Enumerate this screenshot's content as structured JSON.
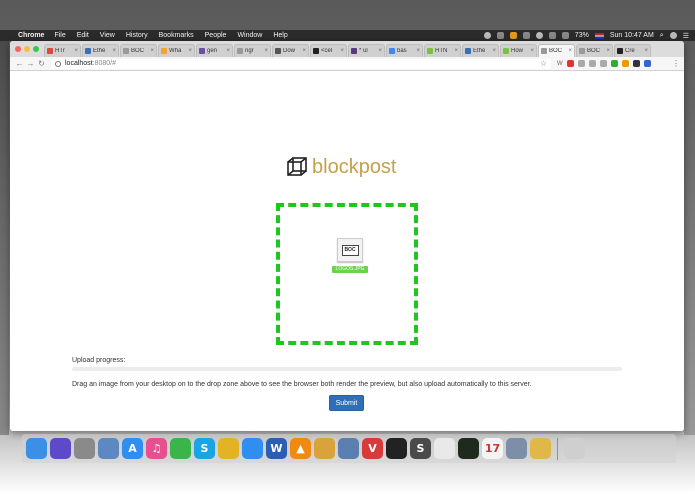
{
  "menubar": {
    "app_name": "Chrome",
    "menus": [
      "File",
      "Edit",
      "View",
      "History",
      "Bookmarks",
      "People",
      "Window",
      "Help"
    ],
    "battery": "73%",
    "clock": "Sun 10:47 AM"
  },
  "tabs": [
    {
      "label": "HTr",
      "favicon_color": "#d84a3b"
    },
    {
      "label": "Ethe",
      "favicon_color": "#3a6fb5"
    },
    {
      "label": "BOC",
      "favicon_color": "#999999"
    },
    {
      "label": "Wha",
      "favicon_color": "#f3a42c"
    },
    {
      "label": "gen",
      "favicon_color": "#6b4fa0"
    },
    {
      "label": "ngr",
      "favicon_color": "#999999"
    },
    {
      "label": "Dow",
      "favicon_color": "#555555"
    },
    {
      "label": "<cel",
      "favicon_color": "#222222"
    },
    {
      "label": "* ul",
      "favicon_color": "#5a3a7a"
    },
    {
      "label": "bas",
      "favicon_color": "#4285f4"
    },
    {
      "label": "HTN",
      "favicon_color": "#7bc043"
    },
    {
      "label": "Ethe",
      "favicon_color": "#3a6fb5"
    },
    {
      "label": "How",
      "favicon_color": "#7bc043"
    },
    {
      "label": "BOC",
      "favicon_color": "#999999",
      "active": true
    },
    {
      "label": "BOC",
      "favicon_color": "#999999"
    },
    {
      "label": "Cre",
      "favicon_color": "#222222"
    }
  ],
  "toolbar": {
    "url_host": "localhost",
    "url_path": ":8080/#",
    "extension_label": "W"
  },
  "page": {
    "brand": "blockpost",
    "brand_icon": "cube-icon",
    "dropped_file": {
      "name": "LOGOS.JPG",
      "thumb_text": "BOC"
    },
    "progress_label": "Upload progress:",
    "progress_percent": 0,
    "help_text": "Drag an image from your desktop on to the drop zone above to see the browser both render the preview, but also upload automatically to this server.",
    "submit_label": "Submit"
  },
  "dock": {
    "apps": [
      {
        "name": "finder-icon",
        "color": "#3c8fe6",
        "glyph": ""
      },
      {
        "name": "siri-icon",
        "color": "#5b4ac9",
        "glyph": ""
      },
      {
        "name": "launchpad-icon",
        "color": "#8a8a8a",
        "glyph": ""
      },
      {
        "name": "preview-icon",
        "color": "#5d88c2",
        "glyph": ""
      },
      {
        "name": "app-store-icon",
        "color": "#2f8ef0",
        "glyph": "A"
      },
      {
        "name": "itunes-icon",
        "color": "#e6508f",
        "glyph": "♫"
      },
      {
        "name": "facetime-icon",
        "color": "#3bb54a",
        "glyph": ""
      },
      {
        "name": "skype-icon",
        "color": "#18a5e6",
        "glyph": "S"
      },
      {
        "name": "chrome-icon",
        "color": "#e2b325",
        "glyph": ""
      },
      {
        "name": "safari-icon",
        "color": "#2f8ef0",
        "glyph": ""
      },
      {
        "name": "word-icon",
        "color": "#2b5fb3",
        "glyph": "W"
      },
      {
        "name": "vlc-icon",
        "color": "#f08a12",
        "glyph": "▲"
      },
      {
        "name": "photos-icon",
        "color": "#d9a23a",
        "glyph": ""
      },
      {
        "name": "xcode-icon",
        "color": "#5a7fb0",
        "glyph": ""
      },
      {
        "name": "vivaldi-icon",
        "color": "#d83a3a",
        "glyph": "V"
      },
      {
        "name": "terminal-icon",
        "color": "#222222",
        "glyph": ""
      },
      {
        "name": "sublime-icon",
        "color": "#4a4a4a",
        "glyph": "S"
      },
      {
        "name": "textedit-icon",
        "color": "#e9e9e9",
        "glyph": ""
      },
      {
        "name": "activity-monitor-icon",
        "color": "#1f2a1f",
        "glyph": ""
      },
      {
        "name": "calendar-icon",
        "color": "#f4f4f4",
        "glyph": "17"
      },
      {
        "name": "remote-desktop-icon",
        "color": "#7d8fa8",
        "glyph": ""
      },
      {
        "name": "pencil-icon",
        "color": "#e0b84a",
        "glyph": ""
      }
    ],
    "trash": {
      "name": "trash-icon",
      "color": "#cfcfcf"
    }
  }
}
